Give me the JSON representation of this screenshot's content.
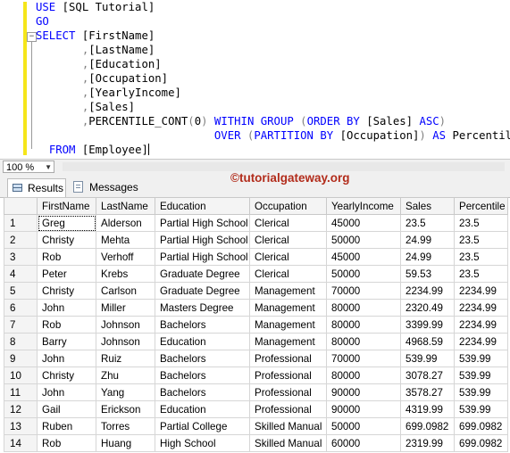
{
  "editor": {
    "lines": [
      [
        {
          "t": "USE ",
          "c": "kw"
        },
        {
          "t": "[SQL Tutorial]",
          "c": ""
        }
      ],
      [
        {
          "t": "GO",
          "c": "kw"
        }
      ],
      [
        {
          "t": "SELECT ",
          "c": "kw"
        },
        {
          "t": "[FirstName]",
          "c": ""
        }
      ],
      [
        {
          "t": "       ",
          "c": ""
        },
        {
          "t": ",",
          "c": "gr"
        },
        {
          "t": "[LastName]",
          "c": ""
        }
      ],
      [
        {
          "t": "       ",
          "c": ""
        },
        {
          "t": ",",
          "c": "gr"
        },
        {
          "t": "[Education]",
          "c": ""
        }
      ],
      [
        {
          "t": "       ",
          "c": ""
        },
        {
          "t": ",",
          "c": "gr"
        },
        {
          "t": "[Occupation]",
          "c": ""
        }
      ],
      [
        {
          "t": "       ",
          "c": ""
        },
        {
          "t": ",",
          "c": "gr"
        },
        {
          "t": "[YearlyIncome]",
          "c": ""
        }
      ],
      [
        {
          "t": "       ",
          "c": ""
        },
        {
          "t": ",",
          "c": "gr"
        },
        {
          "t": "[Sales]",
          "c": ""
        }
      ],
      [
        {
          "t": "       ",
          "c": ""
        },
        {
          "t": ",",
          "c": "gr"
        },
        {
          "t": "PERCENTILE_CONT",
          "c": ""
        },
        {
          "t": "(",
          "c": "gr"
        },
        {
          "t": "0",
          "c": ""
        },
        {
          "t": ") ",
          "c": "gr"
        },
        {
          "t": "WITHIN GROUP ",
          "c": "kw"
        },
        {
          "t": "(",
          "c": "gr"
        },
        {
          "t": "ORDER BY ",
          "c": "kw"
        },
        {
          "t": "[Sales] ",
          "c": ""
        },
        {
          "t": "ASC",
          "c": "kw"
        },
        {
          "t": ")",
          "c": "gr"
        }
      ],
      [
        {
          "t": "                           ",
          "c": ""
        },
        {
          "t": "OVER ",
          "c": "kw"
        },
        {
          "t": "(",
          "c": "gr"
        },
        {
          "t": "PARTITION BY ",
          "c": "kw"
        },
        {
          "t": "[Occupation]",
          "c": ""
        },
        {
          "t": ") ",
          "c": "gr"
        },
        {
          "t": "AS ",
          "c": "kw"
        },
        {
          "t": "Percentile",
          "c": ""
        }
      ],
      [
        {
          "t": "  ",
          "c": ""
        },
        {
          "t": "FROM ",
          "c": "kw"
        },
        {
          "t": "[Employee]",
          "c": ""
        },
        {
          "t": "|caret|",
          "c": "caret"
        }
      ]
    ]
  },
  "zoom": {
    "value": "100 %"
  },
  "tabs": {
    "results": "Results",
    "messages": "Messages"
  },
  "watermark": "©tutorialgateway.org",
  "grid": {
    "columns": [
      "FirstName",
      "LastName",
      "Education",
      "Occupation",
      "YearlyIncome",
      "Sales",
      "Percentile"
    ],
    "rows": [
      [
        "1",
        "Greg",
        "Alderson",
        "Partial High School",
        "Clerical",
        "45000",
        "23.5",
        "23.5"
      ],
      [
        "2",
        "Christy",
        "Mehta",
        "Partial High School",
        "Clerical",
        "50000",
        "24.99",
        "23.5"
      ],
      [
        "3",
        "Rob",
        "Verhoff",
        "Partial High School",
        "Clerical",
        "45000",
        "24.99",
        "23.5"
      ],
      [
        "4",
        "Peter",
        "Krebs",
        "Graduate Degree",
        "Clerical",
        "50000",
        "59.53",
        "23.5"
      ],
      [
        "5",
        "Christy",
        "Carlson",
        "Graduate Degree",
        "Management",
        "70000",
        "2234.99",
        "2234.99"
      ],
      [
        "6",
        "John",
        "Miller",
        "Masters Degree",
        "Management",
        "80000",
        "2320.49",
        "2234.99"
      ],
      [
        "7",
        "Rob",
        "Johnson",
        "Bachelors",
        "Management",
        "80000",
        "3399.99",
        "2234.99"
      ],
      [
        "8",
        "Barry",
        "Johnson",
        "Education",
        "Management",
        "80000",
        "4968.59",
        "2234.99"
      ],
      [
        "9",
        "John",
        "Ruiz",
        "Bachelors",
        "Professional",
        "70000",
        "539.99",
        "539.99"
      ],
      [
        "10",
        "Christy",
        "Zhu",
        "Bachelors",
        "Professional",
        "80000",
        "3078.27",
        "539.99"
      ],
      [
        "11",
        "John",
        "Yang",
        "Bachelors",
        "Professional",
        "90000",
        "3578.27",
        "539.99"
      ],
      [
        "12",
        "Gail",
        "Erickson",
        "Education",
        "Professional",
        "90000",
        "4319.99",
        "539.99"
      ],
      [
        "13",
        "Ruben",
        "Torres",
        "Partial College",
        "Skilled Manual",
        "50000",
        "699.0982",
        "699.0982"
      ],
      [
        "14",
        "Rob",
        "Huang",
        "High School",
        "Skilled Manual",
        "60000",
        "2319.99",
        "699.0982"
      ]
    ]
  }
}
